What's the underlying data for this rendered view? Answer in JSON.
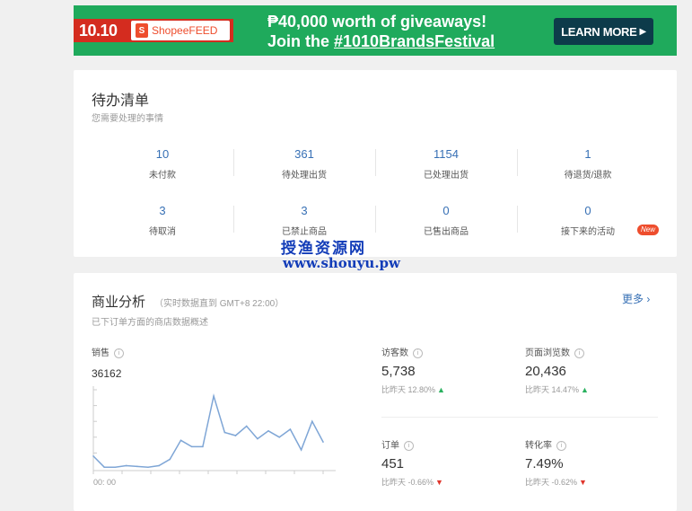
{
  "banner": {
    "badge": "10.10",
    "feed": "ShopeeFEED",
    "line1": "₱40,000 worth of giveaways!",
    "line2_prefix": "Join the ",
    "line2_tag": "#1010BrandsFestival",
    "cta": "LEARN MORE",
    "colors": {
      "background": "#1faa5c",
      "badge": "#d42c1f",
      "cta": "#0d3b4a"
    }
  },
  "todo": {
    "title": "待办清单",
    "subtitle": "您需要处理的事情",
    "items": [
      {
        "value": "10",
        "label": "未付款"
      },
      {
        "value": "361",
        "label": "待处理出货"
      },
      {
        "value": "1154",
        "label": "已处理出货"
      },
      {
        "value": "1",
        "label": "待退货/退款"
      },
      {
        "value": "3",
        "label": "待取消"
      },
      {
        "value": "3",
        "label": "已禁止商品"
      },
      {
        "value": "0",
        "label": "已售出商品"
      },
      {
        "value": "0",
        "label": "接下来的活动"
      }
    ],
    "new_badge": "New"
  },
  "watermark": {
    "line1": "授渔资源网",
    "line2": "www.shouyu.pw"
  },
  "business": {
    "title": "商业分析",
    "note": "（实时数据直到 GMT+8 22:00）",
    "subtitle": "已下订单方面的商店数据概述",
    "more": "更多",
    "sales_label": "销售",
    "sales_value": "36162",
    "time_label": "00: 00",
    "metrics": [
      {
        "label": "访客数",
        "value": "5,738",
        "change": "比昨天 12.80%",
        "direction": "up"
      },
      {
        "label": "页面浏览数",
        "value": "20,436",
        "change": "比昨天 14.47%",
        "direction": "up"
      },
      {
        "label": "订单",
        "value": "451",
        "change": "比昨天 -0.66%",
        "direction": "down"
      },
      {
        "label": "转化率",
        "value": "7.49%",
        "change": "比昨天 -0.62%",
        "direction": "down"
      }
    ]
  },
  "chart_data": {
    "type": "line",
    "title": "",
    "xlabel": "",
    "ylabel": "",
    "series": [
      {
        "values": [
          8,
          1,
          1,
          2,
          1.5,
          1,
          2,
          6,
          18,
          14,
          14,
          46,
          23,
          21,
          27,
          19,
          24,
          20,
          25,
          12,
          30,
          17
        ]
      }
    ],
    "ylim": [
      0,
      50
    ],
    "grid": false
  }
}
